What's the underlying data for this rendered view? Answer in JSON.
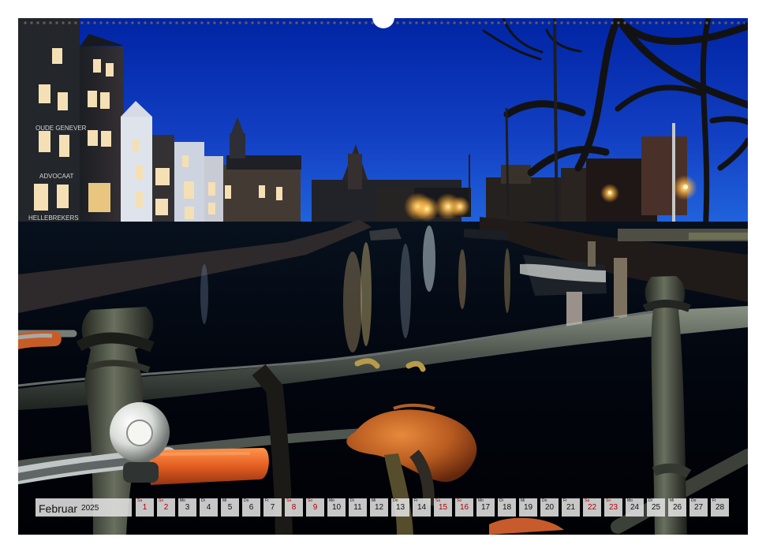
{
  "calendar": {
    "month": "Februar",
    "year": "2025",
    "days": [
      {
        "number": "1",
        "weekday": "Sa",
        "weekend": true
      },
      {
        "number": "2",
        "weekday": "So",
        "weekend": true
      },
      {
        "number": "3",
        "weekday": "Mo",
        "weekend": false
      },
      {
        "number": "4",
        "weekday": "Di",
        "weekend": false
      },
      {
        "number": "5",
        "weekday": "Mi",
        "weekend": false
      },
      {
        "number": "6",
        "weekday": "Do",
        "weekend": false
      },
      {
        "number": "7",
        "weekday": "Fr",
        "weekend": false
      },
      {
        "number": "8",
        "weekday": "Sa",
        "weekend": true
      },
      {
        "number": "9",
        "weekday": "So",
        "weekend": true
      },
      {
        "number": "10",
        "weekday": "Mo",
        "weekend": false
      },
      {
        "number": "11",
        "weekday": "Di",
        "weekend": false
      },
      {
        "number": "12",
        "weekday": "Mi",
        "weekend": false
      },
      {
        "number": "13",
        "weekday": "Do",
        "weekend": false
      },
      {
        "number": "14",
        "weekday": "Fr",
        "weekend": false
      },
      {
        "number": "15",
        "weekday": "Sa",
        "weekend": true
      },
      {
        "number": "16",
        "weekday": "So",
        "weekend": true
      },
      {
        "number": "17",
        "weekday": "Mo",
        "weekend": false
      },
      {
        "number": "18",
        "weekday": "Di",
        "weekend": false
      },
      {
        "number": "19",
        "weekday": "Mi",
        "weekend": false
      },
      {
        "number": "20",
        "weekday": "Do",
        "weekend": false
      },
      {
        "number": "21",
        "weekday": "Fr",
        "weekend": false
      },
      {
        "number": "22",
        "weekday": "Sa",
        "weekend": true
      },
      {
        "number": "23",
        "weekday": "So",
        "weekend": true
      },
      {
        "number": "24",
        "weekday": "Mo",
        "weekend": false
      },
      {
        "number": "25",
        "weekday": "Di",
        "weekend": false
      },
      {
        "number": "26",
        "weekday": "Mi",
        "weekend": false
      },
      {
        "number": "27",
        "weekday": "Do",
        "weekend": false
      },
      {
        "number": "28",
        "weekday": "Fr",
        "weekend": false
      }
    ]
  },
  "scene_signs": {
    "oude_genever": "OUDE GENEVER",
    "advocaat": "ADVOCAAT",
    "hellebrekers": "HELLEBREKERS"
  },
  "colors": {
    "sky": "#1239b8",
    "water": "#02040b",
    "lights": "#ffc75a",
    "bike_handle": "#e36727",
    "bike_saddle": "#b95d1f"
  }
}
